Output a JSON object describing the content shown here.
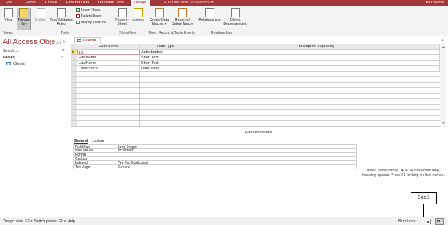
{
  "tabs": [
    "File",
    "Home",
    "Create",
    "External Data",
    "Database Tools",
    "Design"
  ],
  "active_tab": "Design",
  "tell_me": "Tell me what you want to do...",
  "user_name": "Your Name",
  "ribbon": {
    "view": "View",
    "primary_key": [
      "Primary",
      "Key"
    ],
    "builder": "Builder",
    "test_validation": [
      "Test Validation",
      "Rules"
    ],
    "insert_rows": "Insert Rows",
    "delete_rows": "Delete Rows",
    "modify_lookups": "Modify Lookups",
    "property_sheet": [
      "Property",
      "Sheet"
    ],
    "indexes": "Indexes",
    "create_data_macros": [
      "Create Data",
      "Macros ▾"
    ],
    "rename_delete_macro": [
      "Rename/",
      "Delete Macro"
    ],
    "relationships": "Relationships",
    "object_dependencies": [
      "Object",
      "Dependencies"
    ],
    "groups": {
      "views": "Views",
      "tools": "Tools",
      "show_hide": "Show/Hide",
      "field_events": "Field, Record & Table Events",
      "relationships": "Relationships"
    }
  },
  "nav": {
    "title": "All Access Obje...",
    "search_placeholder": "Search...",
    "section": "Tables",
    "items": [
      "Clients"
    ]
  },
  "document_tab": "Clients",
  "grid": {
    "headers": [
      "Field Name",
      "Data Type",
      "Description (Optional)"
    ],
    "rows": [
      {
        "field": "ID",
        "type": "AutoNumber",
        "desc": ""
      },
      {
        "field": "FirstName",
        "type": "Short Text",
        "desc": ""
      },
      {
        "field": "LastName",
        "type": "Short Text",
        "desc": ""
      },
      {
        "field": "ClientSince",
        "type": "Date/Time",
        "desc": ""
      }
    ]
  },
  "field_properties": {
    "title": "Field Properties",
    "tabs": [
      "General",
      "Lookup"
    ],
    "rows": [
      {
        "name": "Field Size",
        "value": "Long Integer"
      },
      {
        "name": "New Values",
        "value": "Increment"
      },
      {
        "name": "Format",
        "value": ""
      },
      {
        "name": "Caption",
        "value": ""
      },
      {
        "name": "Indexed",
        "value": "Yes (No Duplicates)"
      },
      {
        "name": "Text Align",
        "value": "General"
      }
    ],
    "help": "A field name can be up to 64 characters long, including spaces. Press F1 for help on field names."
  },
  "status": {
    "text": "Design view.  F6 = Switch panes.  F1 = Help.",
    "num_lock": "Num Lock"
  },
  "annotation": "Box 1",
  "colors": {
    "accent": "#a4373a",
    "ribbon_bg": "#f3f3f3",
    "key_yellow": "#e8b600"
  }
}
